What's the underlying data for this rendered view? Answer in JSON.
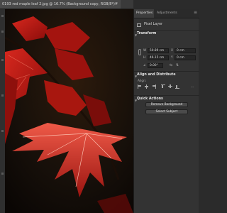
{
  "document": {
    "tab_title": "0193 red maple leaf 2.jpg @ 16.7% (Background copy, RGB/8*) *",
    "close_glyph": "×"
  },
  "panel": {
    "tabs": [
      "Properties",
      "Adjustments"
    ],
    "menu_glyph": "≡",
    "layer_type": "Pixel Layer",
    "transform": {
      "title": "Transform",
      "w_label": "W",
      "w_value": "50.89 cm",
      "h_label": "H",
      "h_value": "46.15 cm",
      "x_label": "X",
      "x_value": "0 cm",
      "y_label": "Y",
      "y_value": "0 cm",
      "angle_label": "∠",
      "angle_value": "0.00°"
    },
    "align": {
      "title": "Align and Distribute",
      "align_label": "Align:"
    },
    "quick_actions": {
      "title": "Quick Actions",
      "remove_bg": "Remove Background",
      "select_subject": "Select Subject"
    }
  },
  "colors": {
    "leaf_red": "#b81a16",
    "leaf_dark": "#6e0a08",
    "background_dark": "#120b07",
    "panel_bg": "#333333"
  }
}
